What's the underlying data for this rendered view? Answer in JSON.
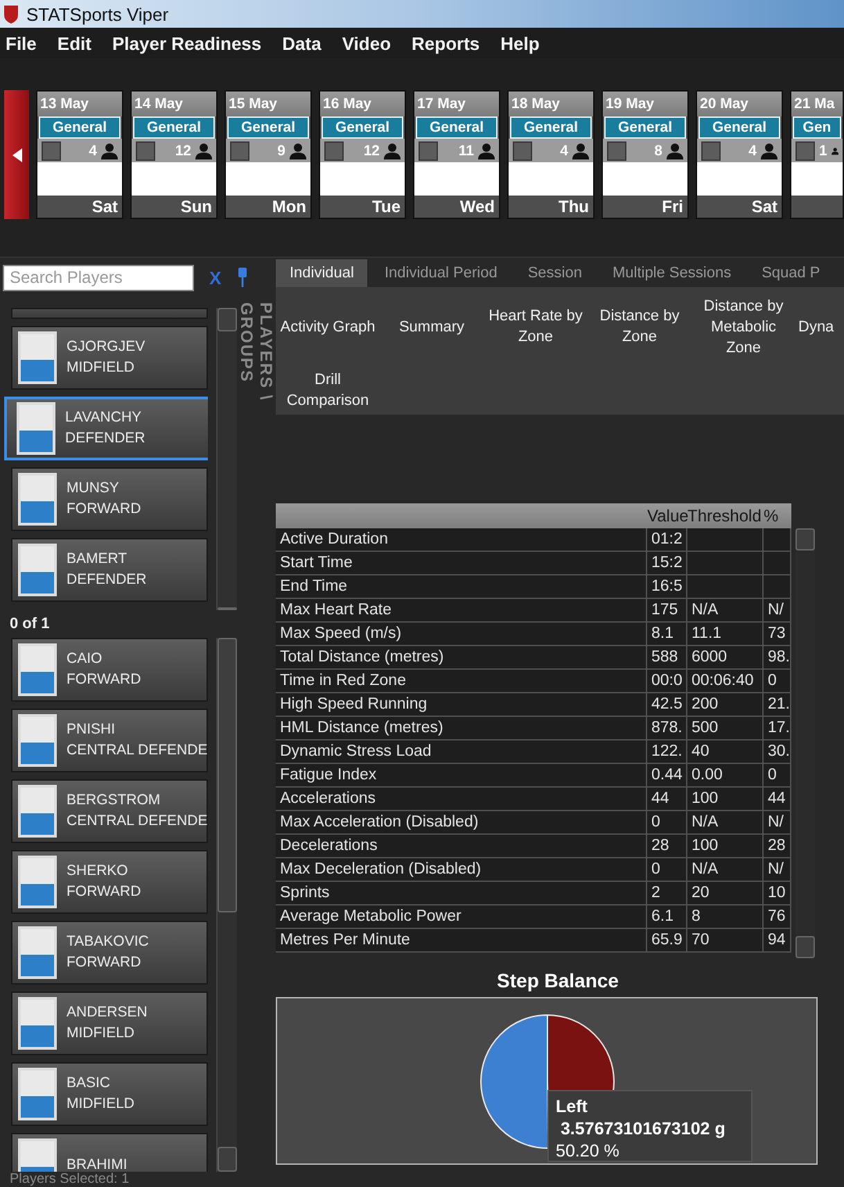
{
  "window": {
    "title": "STATSports Viper"
  },
  "menu": [
    "File",
    "Edit",
    "Player Readiness",
    "Data",
    "Video",
    "Reports",
    "Help"
  ],
  "calendar": [
    {
      "date": "13 May",
      "session": "General",
      "count": "4",
      "weekday": "Sat",
      "checked": false
    },
    {
      "date": "14 May",
      "session": "General",
      "count": "12",
      "weekday": "Sun",
      "checked": false
    },
    {
      "date": "15 May",
      "session": "General",
      "count": "9",
      "weekday": "Mon",
      "checked": false
    },
    {
      "date": "16 May",
      "session": "General",
      "count": "12",
      "weekday": "Tue",
      "checked": false
    },
    {
      "date": "17 May",
      "session": "General",
      "count": "11",
      "weekday": "Wed",
      "checked": false
    },
    {
      "date": "18 May",
      "session": "General",
      "count": "4",
      "weekday": "Thu",
      "checked": false
    },
    {
      "date": "19 May",
      "session": "General",
      "count": "8",
      "weekday": "Fri",
      "checked": false
    },
    {
      "date": "20 May",
      "session": "General",
      "count": "4",
      "weekday": "Sat",
      "checked": false
    },
    {
      "date": "21 Ma",
      "session": "Gen",
      "count": "1",
      "checked": false
    }
  ],
  "search": {
    "placeholder": "Search Players",
    "clear": "X"
  },
  "panel_label": "PLAYERS \\ GROUPS",
  "players_top": [
    {
      "name": "GJORGJEV",
      "position": "MIDFIELD",
      "selected": false
    },
    {
      "name": "LAVANCHY",
      "position": "DEFENDER",
      "selected": true
    },
    {
      "name": "MUNSY",
      "position": "FORWARD",
      "selected": false
    },
    {
      "name": "BAMERT",
      "position": "DEFENDER",
      "selected": false
    }
  ],
  "pager": "0 of 1",
  "players": [
    {
      "name": "CAIO",
      "position": "FORWARD",
      "selected": false
    },
    {
      "name": "PNISHI",
      "position": "CENTRAL DEFENDE",
      "selected": false
    },
    {
      "name": "BERGSTROM",
      "position": "CENTRAL DEFENDE",
      "selected": false
    },
    {
      "name": "SHERKO",
      "position": "FORWARD",
      "selected": false
    },
    {
      "name": "TABAKOVIC",
      "position": "FORWARD",
      "selected": false
    },
    {
      "name": "ANDERSEN",
      "position": "MIDFIELD",
      "selected": false
    },
    {
      "name": "BASIC",
      "position": "MIDFIELD",
      "selected": false
    },
    {
      "name": "BRAHIMI",
      "selected": false
    }
  ],
  "status": "Players Selected: 1",
  "tabs": [
    {
      "label": "Individual",
      "selected": true
    },
    {
      "label": "Individual Period",
      "selected": false
    },
    {
      "label": "Session",
      "selected": false
    },
    {
      "label": "Multiple Sessions",
      "selected": false
    },
    {
      "label": "Squad P",
      "selected": false
    }
  ],
  "subtabs": [
    "Activity Graph",
    "Summary",
    "Heart Rate by Zone",
    "Distance by Zone",
    "Distance by Metabolic Zone",
    "Dyna",
    "Drill Comparison"
  ],
  "table": {
    "columns": [
      "",
      "Value",
      "Threshold",
      "%"
    ],
    "rows": [
      [
        "Active Duration",
        "01:2",
        "",
        ""
      ],
      [
        "Start Time",
        "15:2",
        "",
        ""
      ],
      [
        "End Time",
        "16:5",
        "",
        ""
      ],
      [
        "Max Heart Rate",
        "175",
        "N/A",
        "N/"
      ],
      [
        "Max Speed (m/s)",
        "8.1",
        "11.1",
        "73"
      ],
      [
        "Total Distance (metres)",
        "588",
        "6000",
        "98."
      ],
      [
        "Time in Red Zone",
        "00:0",
        "00:06:40",
        "0"
      ],
      [
        "High Speed Running",
        "42.5",
        "200",
        "21."
      ],
      [
        "HML Distance (metres)",
        "878.",
        "500",
        "17."
      ],
      [
        "Dynamic Stress Load",
        "122.",
        "40",
        "30."
      ],
      [
        "Fatigue Index",
        "0.44",
        "0.00",
        "0"
      ],
      [
        "Accelerations",
        "44",
        "100",
        "44"
      ],
      [
        "Max Acceleration (Disabled)",
        "0",
        "N/A",
        "N/"
      ],
      [
        "Decelerations",
        "28",
        "100",
        "28"
      ],
      [
        "Max Deceleration (Disabled)",
        "0",
        "N/A",
        "N/"
      ],
      [
        "Sprints",
        "2",
        "20",
        "10"
      ],
      [
        "Average Metabolic Power",
        "6.1",
        "8",
        "76"
      ],
      [
        "Metres Per Minute",
        "65.9",
        "70",
        "94"
      ]
    ]
  },
  "step_balance": {
    "title": "Step Balance",
    "tooltip": {
      "title": "Left",
      "value": "3.57673101673102 g",
      "percent": "50.20 %"
    }
  }
}
